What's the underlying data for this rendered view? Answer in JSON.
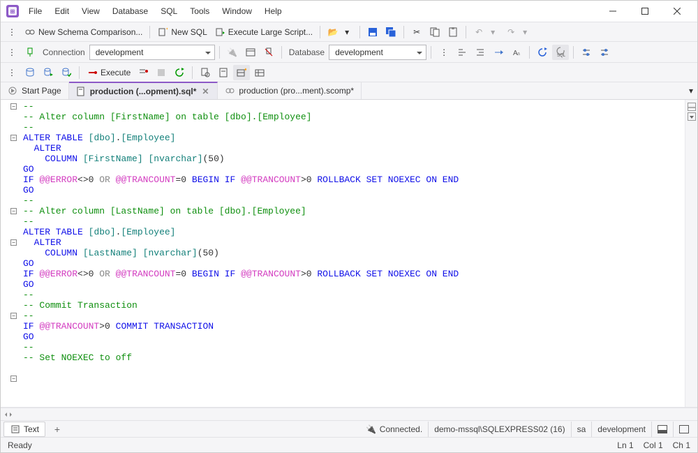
{
  "menu": {
    "file": "File",
    "edit": "Edit",
    "view": "View",
    "database": "Database",
    "sql": "SQL",
    "tools": "Tools",
    "window": "Window",
    "help": "Help"
  },
  "toolbar1": {
    "newSchemaComparison": "New Schema Comparison...",
    "newSQL": "New SQL",
    "executeLargeScript": "Execute Large Script..."
  },
  "toolbar2": {
    "connectionLabel": "Connection",
    "connectionValue": "development",
    "databaseLabel": "Database",
    "databaseValue": "development",
    "sqlBtn": "SQL"
  },
  "toolbar3": {
    "execute": "Execute"
  },
  "tabs": {
    "startPage": "Start Page",
    "active": "production (...opment).sql*",
    "second": "production (pro...ment).scomp*"
  },
  "code_lines": [
    {
      "fold": false,
      "t": [
        {
          "c": "cm-comment",
          "s": "--"
        }
      ]
    },
    {
      "fold": false,
      "t": [
        {
          "c": "cm-comment",
          "s": "-- Alter column [FirstName] on table [dbo].[Employee]"
        }
      ]
    },
    {
      "fold": false,
      "t": [
        {
          "c": "cm-comment",
          "s": "--"
        }
      ]
    },
    {
      "fold": true,
      "t": [
        {
          "c": "cm-kw",
          "s": "ALTER TABLE"
        },
        {
          "c": "",
          "s": " "
        },
        {
          "c": "cm-obj",
          "s": "[dbo]"
        },
        {
          "c": "",
          "s": "."
        },
        {
          "c": "cm-obj",
          "s": "[Employee]"
        }
      ]
    },
    {
      "fold": false,
      "indent": 1,
      "t": [
        {
          "c": "cm-kw",
          "s": "ALTER"
        }
      ]
    },
    {
      "fold": false,
      "indent": 2,
      "t": [
        {
          "c": "cm-kw",
          "s": "COLUMN"
        },
        {
          "c": "",
          "s": " "
        },
        {
          "c": "cm-obj",
          "s": "[FirstName]"
        },
        {
          "c": "",
          "s": " "
        },
        {
          "c": "cm-obj",
          "s": "[nvarchar]"
        },
        {
          "c": "",
          "s": "(50)"
        }
      ]
    },
    {
      "fold": false,
      "t": [
        {
          "c": "cm-kw",
          "s": "GO"
        }
      ]
    },
    {
      "fold": false,
      "t": [
        {
          "c": "cm-kw",
          "s": "IF"
        },
        {
          "c": "",
          "s": " "
        },
        {
          "c": "cm-sys",
          "s": "@@ERROR"
        },
        {
          "c": "",
          "s": "<>0 "
        },
        {
          "c": "cm-op",
          "s": "OR"
        },
        {
          "c": "",
          "s": " "
        },
        {
          "c": "cm-sys",
          "s": "@@TRANCOUNT"
        },
        {
          "c": "",
          "s": "=0 "
        },
        {
          "c": "cm-kw",
          "s": "BEGIN IF"
        },
        {
          "c": "",
          "s": " "
        },
        {
          "c": "cm-sys",
          "s": "@@TRANCOUNT"
        },
        {
          "c": "",
          "s": ">0 "
        },
        {
          "c": "cm-kw",
          "s": "ROLLBACK SET NOEXEC ON END"
        }
      ]
    },
    {
      "fold": false,
      "t": [
        {
          "c": "cm-kw",
          "s": "GO"
        }
      ]
    },
    {
      "fold": false,
      "t": [
        {
          "c": "",
          "s": ""
        }
      ]
    },
    {
      "fold": false,
      "t": [
        {
          "c": "cm-comment",
          "s": "--"
        }
      ]
    },
    {
      "fold": false,
      "t": [
        {
          "c": "cm-comment",
          "s": "-- Alter column [LastName] on table [dbo].[Employee]"
        }
      ]
    },
    {
      "fold": false,
      "t": [
        {
          "c": "cm-comment",
          "s": "--"
        }
      ]
    },
    {
      "fold": true,
      "t": [
        {
          "c": "cm-kw",
          "s": "ALTER TABLE"
        },
        {
          "c": "",
          "s": " "
        },
        {
          "c": "cm-obj",
          "s": "[dbo]"
        },
        {
          "c": "",
          "s": "."
        },
        {
          "c": "cm-obj",
          "s": "[Employee]"
        }
      ]
    },
    {
      "fold": false,
      "indent": 1,
      "t": [
        {
          "c": "cm-kw",
          "s": "ALTER"
        }
      ]
    },
    {
      "fold": false,
      "indent": 2,
      "t": [
        {
          "c": "cm-kw",
          "s": "COLUMN"
        },
        {
          "c": "",
          "s": " "
        },
        {
          "c": "cm-obj",
          "s": "[LastName]"
        },
        {
          "c": "",
          "s": " "
        },
        {
          "c": "cm-obj",
          "s": "[nvarchar]"
        },
        {
          "c": "",
          "s": "(50)"
        }
      ]
    },
    {
      "fold": false,
      "t": [
        {
          "c": "cm-kw",
          "s": "GO"
        }
      ]
    },
    {
      "fold": false,
      "t": [
        {
          "c": "cm-kw",
          "s": "IF"
        },
        {
          "c": "",
          "s": " "
        },
        {
          "c": "cm-sys",
          "s": "@@ERROR"
        },
        {
          "c": "",
          "s": "<>0 "
        },
        {
          "c": "cm-op",
          "s": "OR"
        },
        {
          "c": "",
          "s": " "
        },
        {
          "c": "cm-sys",
          "s": "@@TRANCOUNT"
        },
        {
          "c": "",
          "s": "=0 "
        },
        {
          "c": "cm-kw",
          "s": "BEGIN IF"
        },
        {
          "c": "",
          "s": " "
        },
        {
          "c": "cm-sys",
          "s": "@@TRANCOUNT"
        },
        {
          "c": "",
          "s": ">0 "
        },
        {
          "c": "cm-kw",
          "s": "ROLLBACK SET NOEXEC ON END"
        }
      ]
    },
    {
      "fold": false,
      "t": [
        {
          "c": "cm-kw",
          "s": "GO"
        }
      ]
    },
    {
      "fold": false,
      "t": [
        {
          "c": "",
          "s": ""
        }
      ]
    },
    {
      "fold": false,
      "t": [
        {
          "c": "cm-comment",
          "s": "--"
        }
      ]
    },
    {
      "fold": false,
      "t": [
        {
          "c": "cm-comment",
          "s": "-- Commit Transaction"
        }
      ]
    },
    {
      "fold": false,
      "t": [
        {
          "c": "cm-comment",
          "s": "--"
        }
      ]
    },
    {
      "fold": false,
      "t": [
        {
          "c": "cm-kw",
          "s": "IF"
        },
        {
          "c": "",
          "s": " "
        },
        {
          "c": "cm-sys",
          "s": "@@TRANCOUNT"
        },
        {
          "c": "",
          "s": ">0 "
        },
        {
          "c": "cm-kw",
          "s": "COMMIT TRANSACTION"
        }
      ]
    },
    {
      "fold": false,
      "t": [
        {
          "c": "cm-kw",
          "s": "GO"
        }
      ]
    },
    {
      "fold": false,
      "t": [
        {
          "c": "",
          "s": ""
        }
      ]
    },
    {
      "fold": false,
      "t": [
        {
          "c": "cm-comment",
          "s": "--"
        }
      ]
    },
    {
      "fold": false,
      "t": [
        {
          "c": "cm-comment",
          "s": "-- Set NOEXEC to off"
        }
      ]
    }
  ],
  "bottom": {
    "textTab": "Text",
    "connected": "Connected.",
    "server": "demo-mssql\\SQLEXPRESS02 (16)",
    "user": "sa",
    "db": "development"
  },
  "status": {
    "ready": "Ready",
    "ln": "Ln 1",
    "col": "Col 1",
    "ch": "Ch 1"
  }
}
